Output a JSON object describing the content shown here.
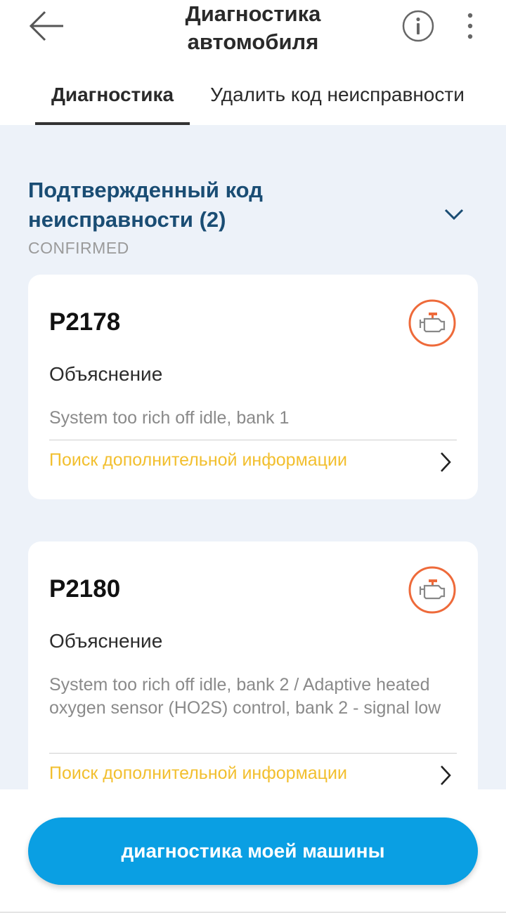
{
  "header": {
    "title": "Диагностика автомобиля",
    "icons": {
      "back": "arrow-left-icon",
      "info": "info-circle-icon",
      "more": "more-vertical-icon"
    }
  },
  "tabs": [
    {
      "label": "Диагностика",
      "active": true
    },
    {
      "label": "Удалить код неисправности",
      "active": false
    }
  ],
  "section": {
    "title": "Подтвержденный код неисправности (2)",
    "subtitle": "CONFIRMED",
    "expand_icon": "chevron-down-icon"
  },
  "fault_codes": [
    {
      "code": "P2178",
      "explanation_label": "Объяснение",
      "explanation": "System too rich off idle, bank 1",
      "more_info_link": "Поиск дополнительной информации",
      "icon": "check-engine-icon"
    },
    {
      "code": "P2180",
      "explanation_label": "Объяснение",
      "explanation": "System too rich off idle, bank 2 / Adaptive heated oxygen sensor (HO2S) control, bank 2 - signal low",
      "more_info_link": "Поиск дополнительной информации",
      "icon": "check-engine-icon"
    }
  ],
  "primary_button": {
    "label": "диагностика моей машины"
  },
  "colors": {
    "accent_blue": "#0a9fe3",
    "section_title": "#1a4d74",
    "link_yellow": "#f2bf2e",
    "engine_icon_orange": "#ee6a3a",
    "content_bg": "#edf2f9"
  }
}
